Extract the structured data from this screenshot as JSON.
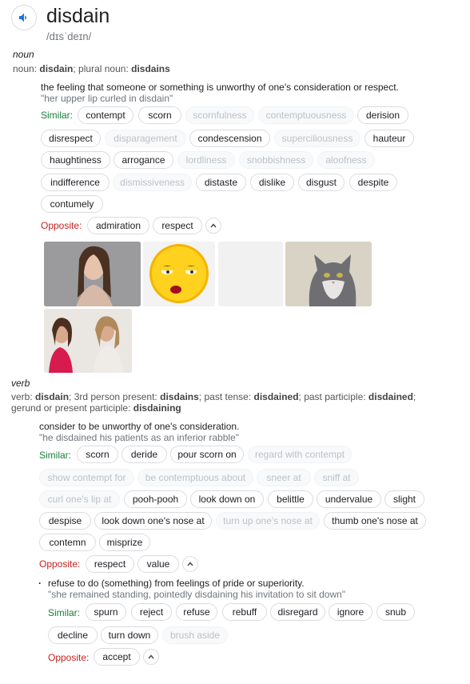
{
  "header": {
    "word": "disdain",
    "phonetic": "/dɪsˈdeɪn/",
    "speaker_icon": "speaker-icon"
  },
  "noun": {
    "pos": "noun",
    "forms_prefix": "noun: ",
    "forms_word": "disdain",
    "forms_mid": "; plural noun: ",
    "forms_plural": "disdains",
    "definition": "the feeling that someone or something is unworthy of one's consideration or respect.",
    "example": "\"her upper lip curled in disdain\"",
    "similar_label": "Similar:",
    "similar": [
      [
        "contempt",
        "scorn",
        "scornfulness",
        "contemptuousness",
        "derision"
      ],
      [
        "disrespect",
        "disparagement",
        "condescension",
        "superciliousness",
        "hauteur"
      ],
      [
        "haughtiness",
        "arrogance",
        "lordliness",
        "snobbishness",
        "aloofness"
      ],
      [
        "indifference",
        "dismissiveness",
        "distaste",
        "dislike",
        "disgust",
        "despite"
      ],
      [
        "contumely"
      ]
    ],
    "opposite_label": "Opposite:",
    "opposite": [
      "admiration",
      "respect"
    ]
  },
  "images": [
    {
      "name": "woman-disdain-photo",
      "alt": "woman"
    },
    {
      "name": "emoji-disdain-image",
      "alt": "emoji"
    },
    {
      "name": "blank-image",
      "alt": ""
    },
    {
      "name": "cat-photo",
      "alt": "cat"
    },
    {
      "name": "two-women-photo",
      "alt": "women"
    }
  ],
  "verb": {
    "pos": "verb",
    "line1": {
      "p1": "verb: ",
      "b1": "disdain",
      "p2": "; 3rd person present: ",
      "b2": "disdains",
      "p3": "; past tense: ",
      "b3": "disdained",
      "p4": "; past participle: ",
      "b4": "disdained",
      "p5": ";"
    },
    "line2": {
      "p1": "gerund or present participle: ",
      "b1": "disdaining"
    },
    "sense1": {
      "definition": "consider to be unworthy of one's consideration.",
      "example": "\"he disdained his patients as an inferior rabble\"",
      "similar_label": "Similar:",
      "similar": [
        [
          "scorn",
          "deride",
          "pour scorn on",
          "regard with contempt"
        ],
        [
          "show contempt for",
          "be contemptuous about",
          "sneer at",
          "sniff at"
        ],
        [
          "curl one's lip at",
          "pooh-pooh",
          "look down on",
          "belittle",
          "undervalue",
          "slight"
        ],
        [
          "despise",
          "look down one's nose at",
          "turn up one's nose at",
          "thumb one's nose at"
        ],
        [
          "contemn",
          "misprize"
        ]
      ],
      "opposite_label": "Opposite:",
      "opposite": [
        "respect",
        "value"
      ]
    },
    "sense2": {
      "bullet": "·",
      "definition": "refuse to do (something) from feelings of pride or superiority.",
      "example": "\"she remained standing, pointedly disdaining his invitation to sit down\"",
      "similar_label": "Similar:",
      "similar": [
        [
          "spurn",
          "reject",
          "refuse",
          "rebuff",
          "disregard",
          "ignore",
          "snub"
        ],
        [
          "decline",
          "turn down",
          "brush aside"
        ]
      ],
      "opposite_label": "Opposite:",
      "opposite": [
        "accept"
      ]
    }
  },
  "colors": {
    "similar": "#188038",
    "opposite": "#c5221f",
    "chip_border": "#dadce0",
    "chip_dim_text": "#bdc1c6",
    "speaker": "#1a73e8"
  }
}
